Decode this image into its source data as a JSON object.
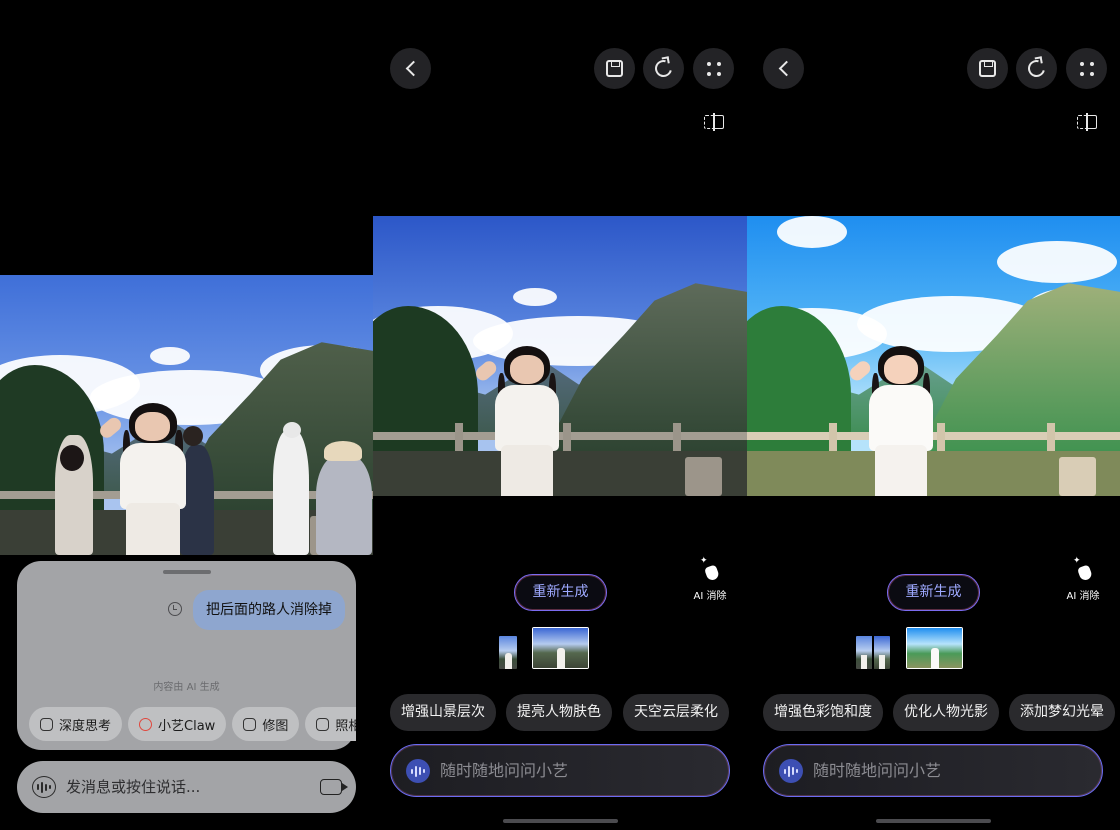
{
  "panel1": {
    "chat_message": "把后面的路人消除掉",
    "ai_note": "内容由 AI 生成",
    "chips": [
      {
        "label": "深度思考",
        "icon": "atom-icon"
      },
      {
        "label": "小艺Claw",
        "icon": "claw-icon"
      },
      {
        "label": "修图",
        "icon": "image-edit-icon"
      },
      {
        "label": "照相",
        "icon": "camera-icon"
      }
    ],
    "input_placeholder": "发消息或按住说话..."
  },
  "panel2": {
    "regenerate_label": "重新生成",
    "ai_erase_label": "AI 消除",
    "suggestions": [
      "增强山景层次",
      "提亮人物肤色",
      "天空云层柔化"
    ],
    "ask_placeholder": "随时随地问问小艺"
  },
  "panel3": {
    "regenerate_label": "重新生成",
    "ai_erase_label": "AI 消除",
    "suggestions": [
      "增强色彩饱和度",
      "优化人物光影",
      "添加梦幻光晕"
    ],
    "ask_placeholder": "随时随地问问小艺"
  },
  "colors": {
    "background": "#000000",
    "chat_card": "#a3a4a7",
    "user_bubble": "#8ea6cf",
    "chip_dark": "#2a2a2d",
    "accent_gradient_start": "#6a6cf2",
    "accent_gradient_end": "#e878c8"
  }
}
